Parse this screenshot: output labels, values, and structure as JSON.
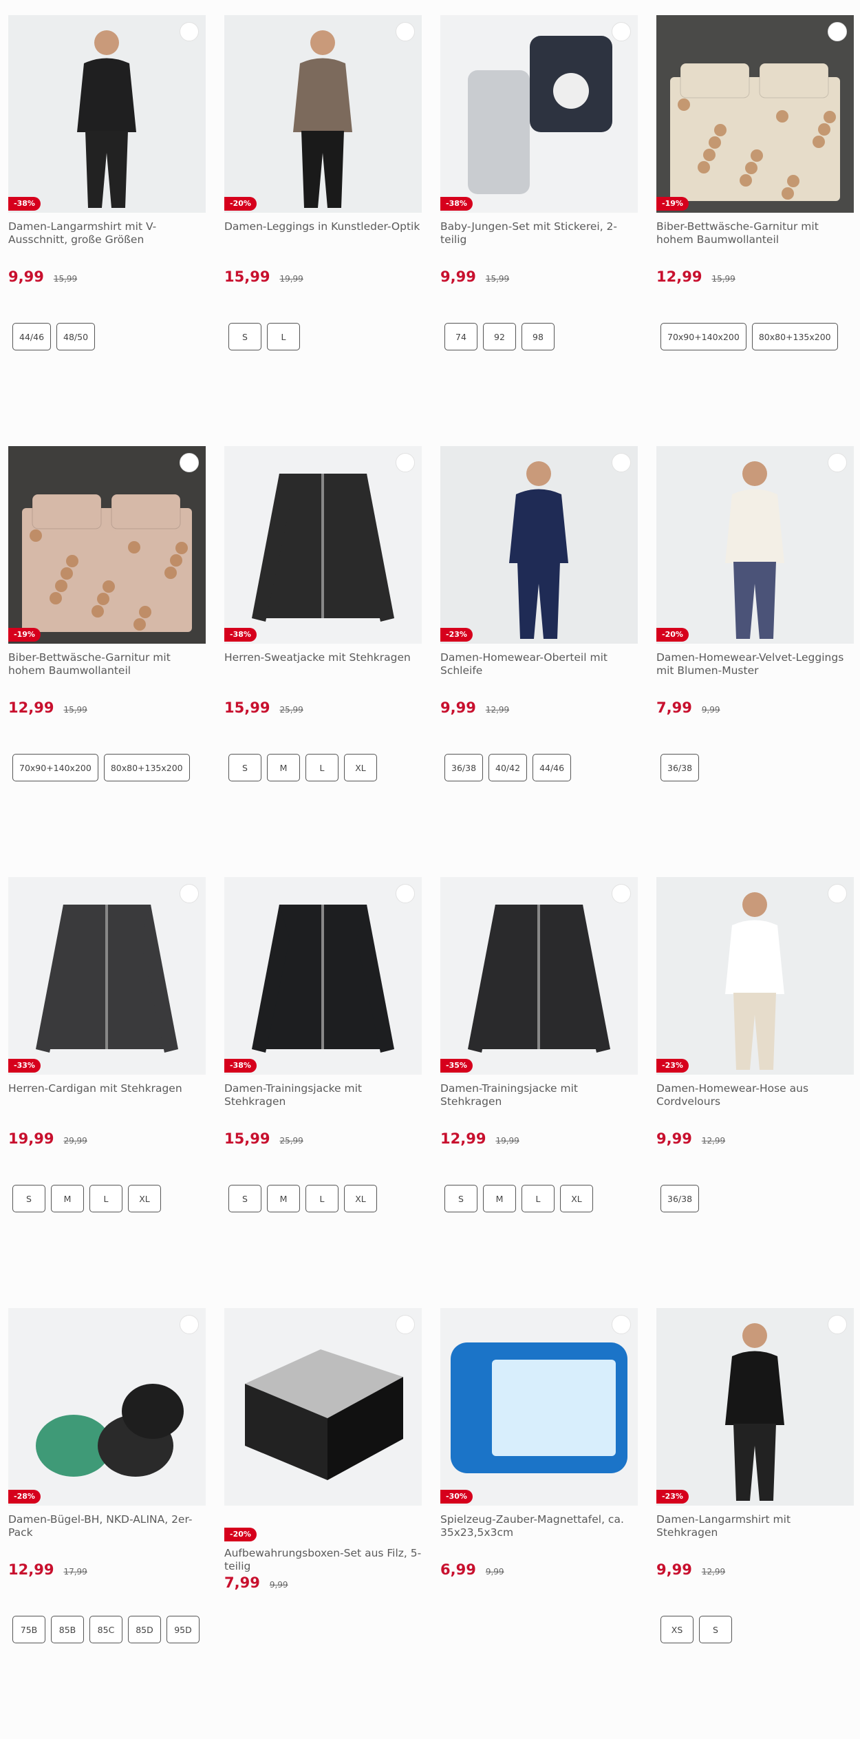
{
  "products": [
    {
      "title": "Damen-Langarmshirt mit V-Ausschnitt, große Größen",
      "discount": "-38%",
      "price": "9,99",
      "old_price": "15,99",
      "sizes": [
        "44/46",
        "48/50"
      ],
      "image": "black-shirt-woman",
      "img_colors": [
        "#eceeef",
        "#1f1f20"
      ]
    },
    {
      "title": "Damen-Leggings in Kunstleder-Optik",
      "discount": "-20%",
      "price": "15,99",
      "old_price": "19,99",
      "sizes": [
        "S",
        "L"
      ],
      "image": "leather-leggings-woman",
      "img_colors": [
        "#eceeef",
        "#7c6a5c"
      ]
    },
    {
      "title": "Baby-Jungen-Set mit Stickerei, 2-teilig",
      "discount": "-38%",
      "price": "9,99",
      "old_price": "15,99",
      "sizes": [
        "74",
        "92",
        "98"
      ],
      "image": "baby-set",
      "img_colors": [
        "#f1f2f3",
        "#2d3340"
      ]
    },
    {
      "title": "Biber-Bettwäsche-Garnitur mit hohem Baumwollanteil",
      "discount": "-19%",
      "price": "12,99",
      "old_price": "15,99",
      "sizes": [
        "70x90+140x200",
        "80x80+135x200"
      ],
      "image": "floral-bedding",
      "img_colors": [
        "#4a4a48",
        "#e6dcc9"
      ]
    },
    {
      "title": "Biber-Bettwäsche-Garnitur mit hohem Baumwollanteil",
      "discount": "-19%",
      "price": "12,99",
      "old_price": "15,99",
      "sizes": [
        "70x90+140x200",
        "80x80+135x200"
      ],
      "image": "pink-bedding",
      "img_colors": [
        "#3f3e3c",
        "#d6b9a8"
      ]
    },
    {
      "title": "Herren-Sweatjacke mit Stehkragen",
      "discount": "-38%",
      "price": "15,99",
      "old_price": "25,99",
      "sizes": [
        "S",
        "M",
        "L",
        "XL"
      ],
      "image": "sweat-jacket",
      "img_colors": [
        "#f1f2f3",
        "#2a2a2a"
      ]
    },
    {
      "title": "Damen-Homewear-Oberteil mit Schleife",
      "discount": "-23%",
      "price": "9,99",
      "old_price": "12,99",
      "sizes": [
        "36/38",
        "40/42",
        "44/46"
      ],
      "image": "navy-top-woman",
      "img_colors": [
        "#e9ebec",
        "#1f2b55"
      ]
    },
    {
      "title": "Damen-Homewear-Velvet-Leggings mit Blumen-Muster",
      "discount": "-20%",
      "price": "7,99",
      "old_price": "9,99",
      "sizes": [
        "36/38"
      ],
      "image": "velvet-leggings-woman",
      "img_colors": [
        "#eceeef",
        "#4b5378"
      ]
    },
    {
      "title": "Herren-Cardigan mit Stehkragen",
      "discount": "-33%",
      "price": "19,99",
      "old_price": "29,99",
      "sizes": [
        "S",
        "M",
        "L",
        "XL"
      ],
      "image": "cardigan",
      "img_colors": [
        "#f1f2f3",
        "#3a3a3c"
      ]
    },
    {
      "title": "Damen-Trainingsjacke mit Stehkragen",
      "discount": "-38%",
      "price": "15,99",
      "old_price": "25,99",
      "sizes": [
        "S",
        "M",
        "L",
        "XL"
      ],
      "image": "training-jacket-1",
      "img_colors": [
        "#f1f2f3",
        "#1d1e20"
      ]
    },
    {
      "title": "Damen-Trainingsjacke mit Stehkragen",
      "discount": "-35%",
      "price": "12,99",
      "old_price": "19,99",
      "sizes": [
        "S",
        "M",
        "L",
        "XL"
      ],
      "image": "training-jacket-2",
      "img_colors": [
        "#f1f2f3",
        "#2a2a2c"
      ]
    },
    {
      "title": "Damen-Homewear-Hose aus Cordvelours",
      "discount": "-23%",
      "price": "9,99",
      "old_price": "12,99",
      "sizes": [
        "36/38"
      ],
      "image": "cord-trousers-woman",
      "img_colors": [
        "#eceeef",
        "#e6dccb"
      ]
    },
    {
      "title": "Damen-Bügel-BH, NKD-ALINA, 2er-Pack",
      "discount": "-28%",
      "price": "12,99",
      "old_price": "17,99",
      "sizes": [
        "75B",
        "85B",
        "85C",
        "85D",
        "95D"
      ],
      "image": "bra-pack",
      "img_colors": [
        "#f1f2f3",
        "#3f9a77"
      ]
    },
    {
      "title": "Aufbewahrungsboxen-Set aus Filz, 5-teilig",
      "discount": "-20%",
      "price": "7,99",
      "old_price": "9,99",
      "sizes": [],
      "image": "felt-boxes",
      "img_colors": [
        "#f1f2f3",
        "#222222"
      ],
      "badge_below": true
    },
    {
      "title": "Spielzeug-Zauber-Magnettafel, ca. 35x23,5x3cm",
      "discount": "-30%",
      "price": "6,99",
      "old_price": "9,99",
      "sizes": [],
      "image": "magnetic-board",
      "img_colors": [
        "#f1f2f3",
        "#1b74c8"
      ]
    },
    {
      "title": "Damen-Langarmshirt mit Stehkragen",
      "discount": "-23%",
      "price": "9,99",
      "old_price": "12,99",
      "sizes": [
        "XS",
        "S"
      ],
      "image": "black-turtleneck-woman",
      "img_colors": [
        "#eceeef",
        "#161616"
      ]
    }
  ]
}
